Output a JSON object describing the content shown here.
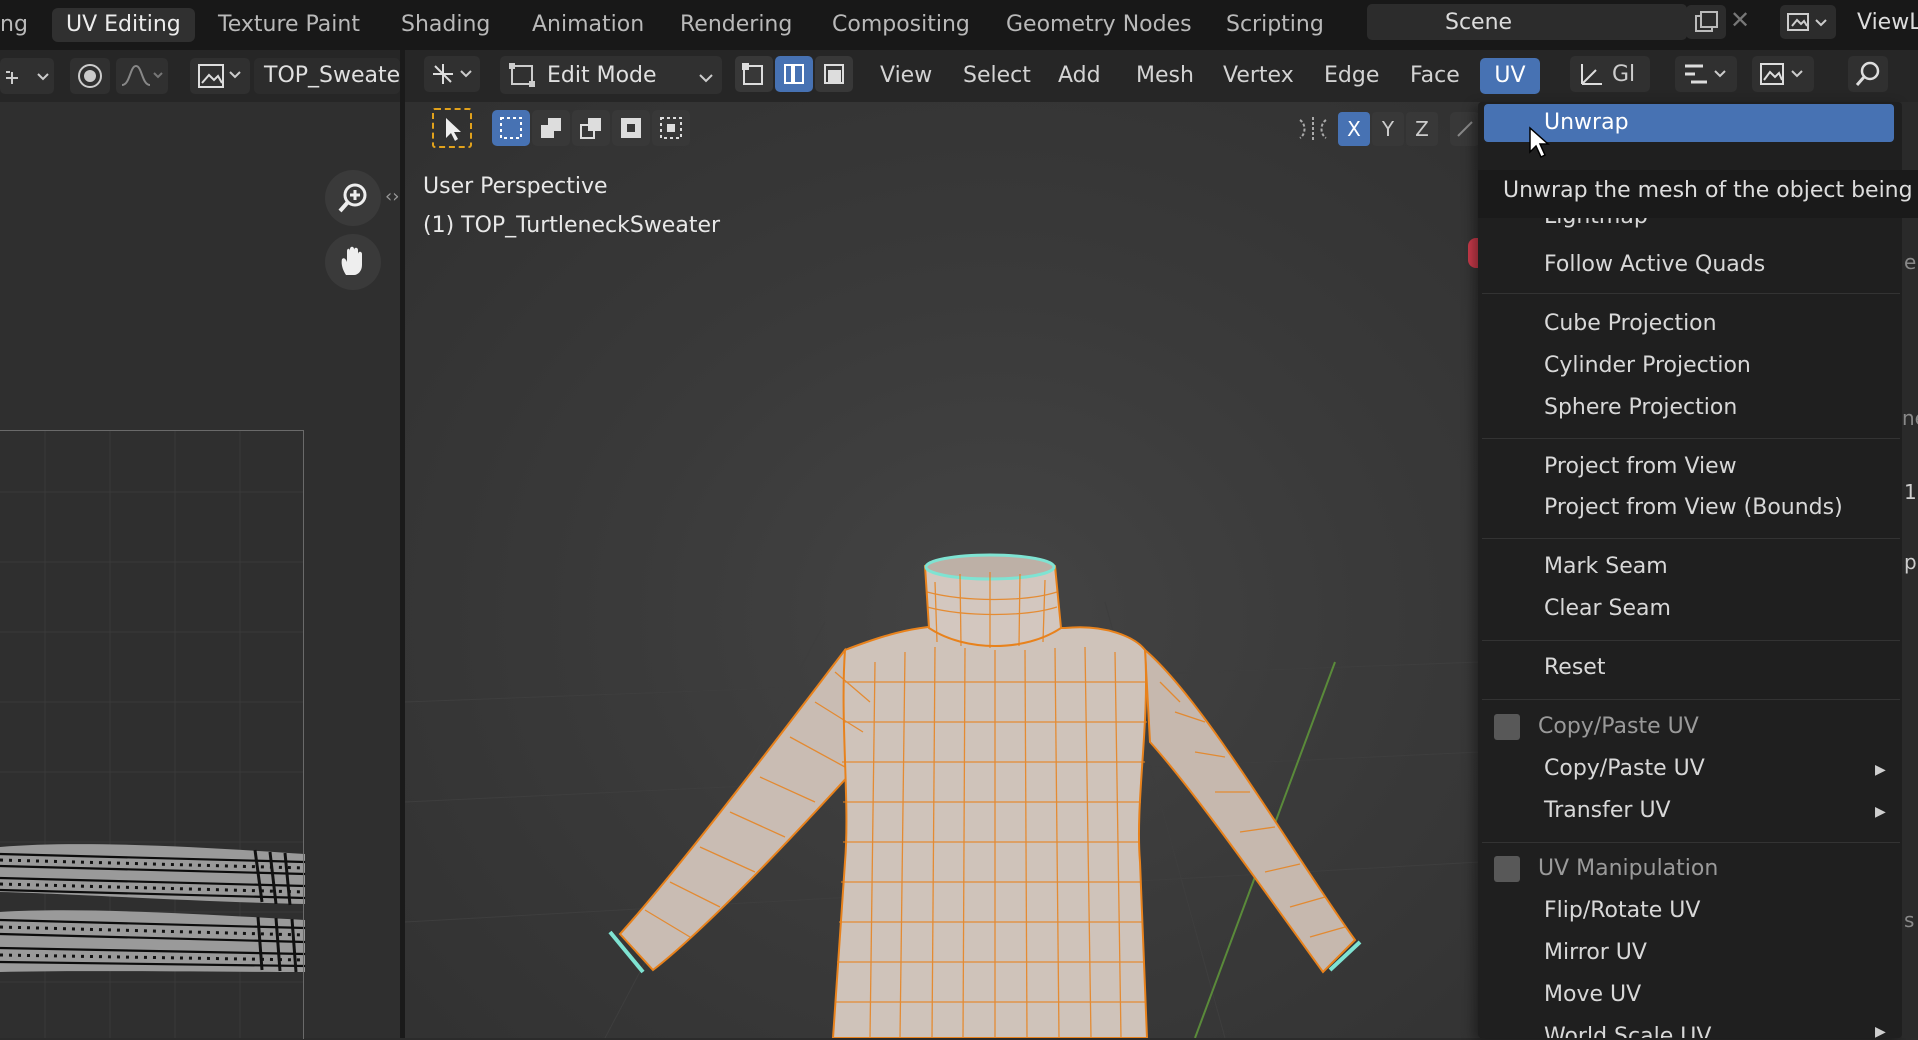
{
  "workspaces": {
    "tabs": [
      {
        "label": "ng",
        "active": false
      },
      {
        "label": "UV Editing",
        "active": true
      },
      {
        "label": "Texture Paint",
        "active": false
      },
      {
        "label": "Shading",
        "active": false
      },
      {
        "label": "Animation",
        "active": false
      },
      {
        "label": "Rendering",
        "active": false
      },
      {
        "label": "Compositing",
        "active": false
      },
      {
        "label": "Geometry Nodes",
        "active": false
      },
      {
        "label": "Scripting",
        "active": false
      }
    ],
    "scene_label": "Scene",
    "view_layer_label": "ViewL"
  },
  "uv_editor": {
    "image_name": "TOP_Sweate"
  },
  "viewport_header": {
    "mode_label": "Edit Mode",
    "menus": [
      "View",
      "Select",
      "Add",
      "Mesh",
      "Vertex",
      "Edge",
      "Face",
      "UV"
    ],
    "active_menu": "UV",
    "transform_label": "Gl",
    "axes": [
      "X",
      "Y",
      "Z"
    ]
  },
  "viewport": {
    "view_name": "User Perspective",
    "object_name": "(1) TOP_TurtleneckSweater"
  },
  "uv_menu": {
    "highlighted_item": "Unwrap",
    "tooltip": "Unwrap the mesh of the object being e",
    "partial_item": "Lightmap Pack",
    "items_group1": [
      "Follow Active Quads"
    ],
    "items_group2": [
      "Cube Projection",
      "Cylinder Projection",
      "Sphere Projection"
    ],
    "items_group3": [
      "Project from View",
      "Project from View (Bounds)"
    ],
    "items_group4": [
      "Mark Seam",
      "Clear Seam"
    ],
    "items_group5": [
      "Reset"
    ],
    "section_copy_paste": "Copy/Paste UV",
    "copy_paste_items": [
      "Copy/Paste UV",
      "Transfer UV"
    ],
    "section_manipulation": "UV Manipulation",
    "manipulation_items": [
      "Flip/Rotate UV",
      "Mirror UV",
      "Move UV",
      "World Scale UV"
    ]
  },
  "right_edge": {
    "fragments": [
      "e",
      "ne",
      "1",
      "p",
      "s"
    ]
  },
  "colors": {
    "accent": "#4772b3",
    "wire_orange": "#e8821c",
    "seam_cyan": "#7fe3d2"
  }
}
